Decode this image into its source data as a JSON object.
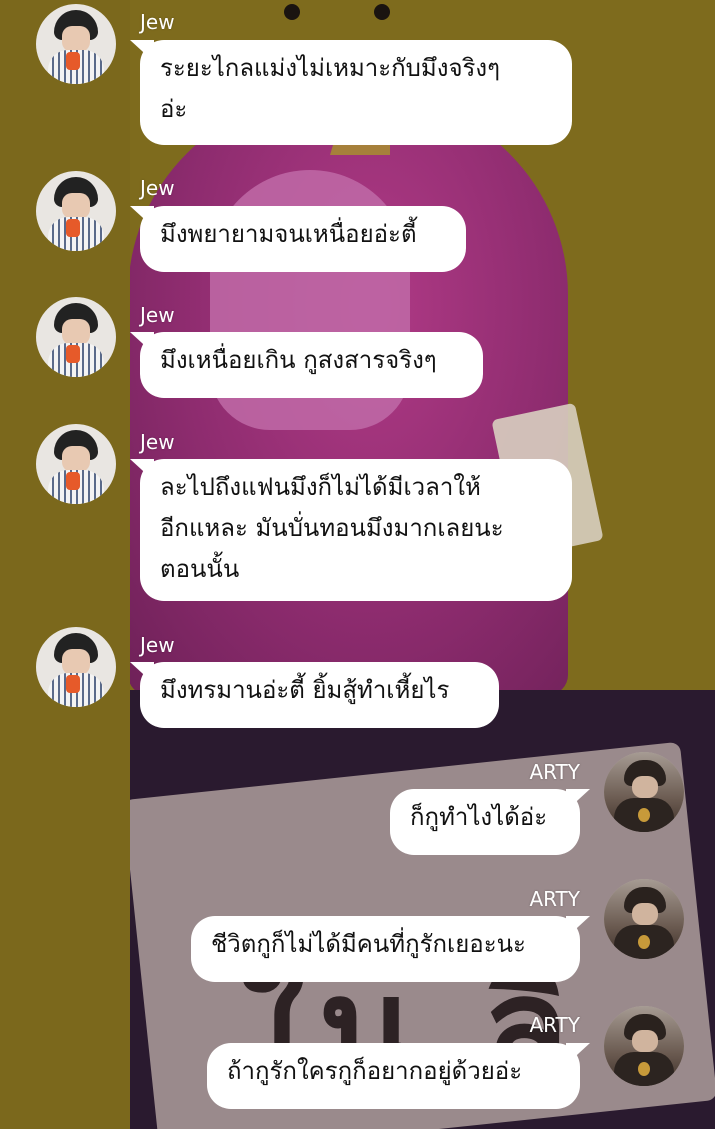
{
  "chat": {
    "messages": [
      {
        "sender": "Jew",
        "side": "left",
        "text": "ระยะไกลแม่งไม่เหมาะกับมึงจริงๆ\nอ่ะ"
      },
      {
        "sender": "Jew",
        "side": "left",
        "text": "มึงพยายามจนเหนื่อยอ่ะตี้"
      },
      {
        "sender": "Jew",
        "side": "left",
        "text": "มึงเหนื่อยเกิน กูสงสารจริงๆ"
      },
      {
        "sender": "Jew",
        "side": "left",
        "text": "ละไปถึงแฟนมึงก็ไม่ได้มีเวลาให้\nอีกแหละ มันบั่นทอนมึงมากเลยนะ\nตอนนั้น"
      },
      {
        "sender": "Jew",
        "side": "left",
        "text": "มึงทรมานอ่ะตี้ ยิ้มสู้ทำเหี้ยไร"
      },
      {
        "sender": "ARTY",
        "side": "right",
        "text": "ก็กูทำไงได้อ่ะ"
      },
      {
        "sender": "ARTY",
        "side": "right",
        "text": "ชีวิตกูก็ไม่ได้มีคนที่กูรักเยอะนะ"
      },
      {
        "sender": "ARTY",
        "side": "right",
        "text": "ถ้ากูรักใครกูก็อยากอยู่ด้วยอ่ะ"
      }
    ]
  },
  "wallpaper": {
    "text": "ใน ลิ"
  },
  "colors": {
    "bubble": "#ffffff",
    "name_text": "#ffffff",
    "wallpaper_yellow": "#7d6a1c",
    "wallpaper_pink": "#8e2c6f",
    "wallpaper_dark": "#2a1a2f"
  }
}
